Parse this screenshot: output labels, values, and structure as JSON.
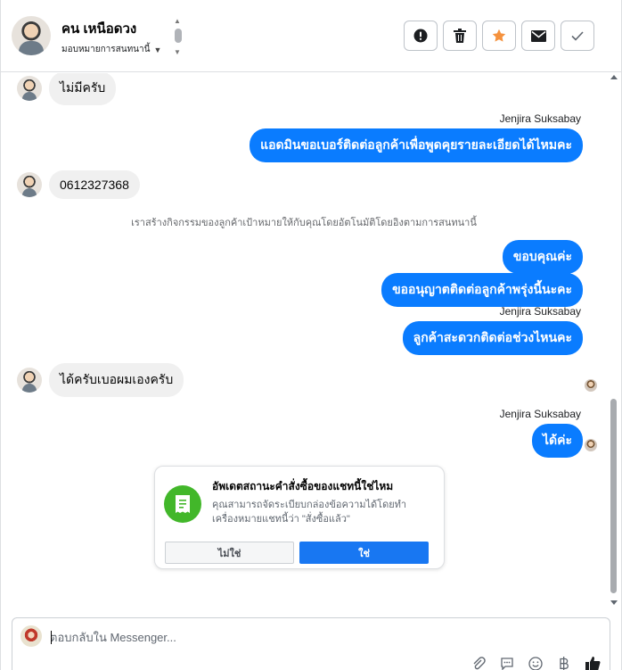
{
  "header": {
    "contact_name": "คน เหนือดวง",
    "assign_label": "มอบหมายการสนทนานี้",
    "buttons": {
      "report": "exclamation-icon",
      "delete": "trash-icon",
      "star": "star-icon",
      "mark_unread": "envelope-icon",
      "done": "check-icon"
    },
    "colors": {
      "star": "#f5923e"
    }
  },
  "messages": {
    "m1": {
      "direction": "incoming",
      "text": "ไม่มีครับ"
    },
    "s1": {
      "sender": "Jenjira Suksabay"
    },
    "m2": {
      "direction": "outgoing",
      "text": "แอดมินขอเบอร์ติดต่อลูกค้าเพื่อพูดคุยรายละเอียดได้ไหมคะ"
    },
    "m3": {
      "direction": "incoming",
      "text": "0612327368"
    },
    "system": "เราสร้างกิจกรรมของลูกค้าเป้าหมายให้กับคุณโดยอัตโนมัติโดยอิงตามการสนทนานี้",
    "m4": {
      "direction": "outgoing",
      "text": "ขอบคุณค่ะ"
    },
    "m5": {
      "direction": "outgoing",
      "text": "ขออนุญาตติดต่อลูกค้าพรุ่งนี้นะคะ"
    },
    "s2": {
      "sender": "Jenjira Suksabay"
    },
    "m6": {
      "direction": "outgoing",
      "text": "ลูกค้าสะดวกติดต่อช่วงไหนคะ"
    },
    "m7": {
      "direction": "incoming",
      "text": "ได้ครับเบอผมเองครับ"
    },
    "s3": {
      "sender": "Jenjira Suksabay"
    },
    "m8": {
      "direction": "outgoing",
      "text": "ได้ค่ะ"
    }
  },
  "order_card": {
    "title": "อัพเดตสถานะคำสั่งซื้อของแชทนี้ใช่ไหม",
    "description": "คุณสามารถจัดระเบียบกล่องข้อความได้โดยทำเครื่องหมายแชทนี้ว่า \"สั่งซื้อแล้ว\"",
    "no_label": "ไม่ใช่",
    "yes_label": "ใช่",
    "icon": "receipt-icon",
    "colors": {
      "icon_bg": "#42b72a",
      "yes_bg": "#1877f2"
    }
  },
  "composer": {
    "placeholder": "ตอบกลับใน Messenger...",
    "tools": [
      "paperclip-icon",
      "saved-reply-icon",
      "emoji-icon",
      "baht-icon",
      "like-icon"
    ]
  },
  "colors": {
    "outgoing_bubble": "#0a7cff",
    "incoming_bubble": "#f0f0f0"
  }
}
